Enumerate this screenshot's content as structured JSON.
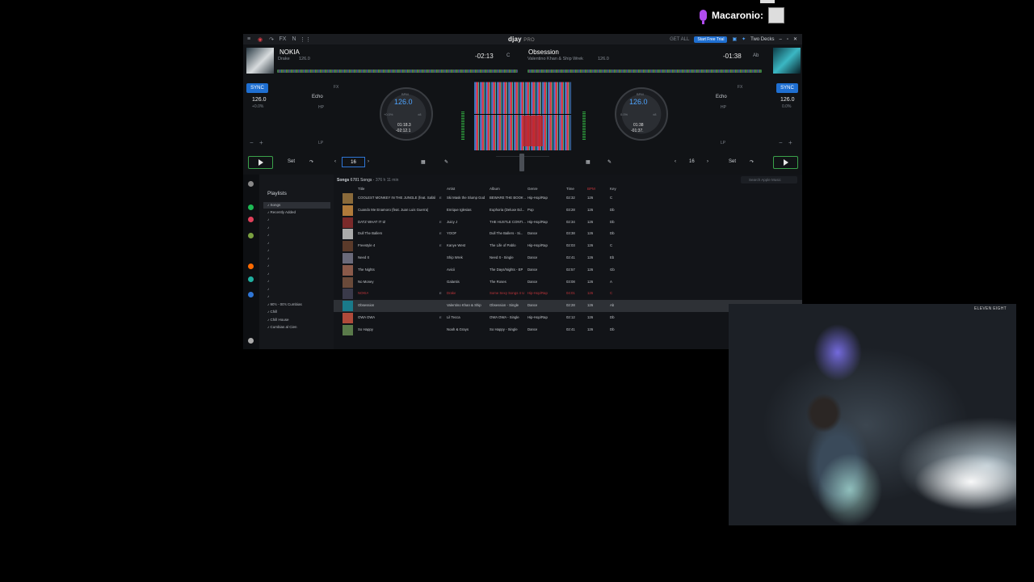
{
  "overlay": {
    "username": "Macaronio:"
  },
  "app": {
    "logo": "djay",
    "logo_sub": "PRO",
    "topbar_status": "GET ALL",
    "topbar_button": "Start Free Trial",
    "layout": "Two Decks"
  },
  "deck_left": {
    "title": "NOKIA",
    "artist": "Drake",
    "bpm_small": "126.0",
    "time": "-02:13",
    "key_small": "C",
    "sync": "SYNC",
    "bpm": "126.0",
    "pitch": "+0.0%",
    "fx": "Echo",
    "fx_tag": "FX",
    "hp": "HP",
    "lp": "LP",
    "jog_label": "BPM",
    "jog_bpm": "126.0",
    "jog_offset": "+0.0%",
    "jog_range": "±8",
    "jog_time1": "01:18.3",
    "jog_time2": "-02:12.1",
    "set": "Set",
    "loop": "16"
  },
  "deck_right": {
    "title": "Obsession",
    "artist": "Valentino Khan & Ship Wrek",
    "bpm_small": "126.0",
    "time": "-01:38",
    "key_small": "Ab",
    "sync": "SYNC",
    "bpm": "126.0",
    "pitch": "0.0%",
    "fx": "Echo",
    "fx_tag": "FX",
    "hp": "HP",
    "lp": "LP",
    "jog_label": "BPM",
    "jog_bpm": "126.0",
    "jog_offset": "0.0%",
    "jog_range": "±8",
    "jog_time1": "01:38",
    "jog_time2": "-01:37.",
    "set": "Set",
    "loop": "16"
  },
  "library": {
    "playlists_title": "Playlists",
    "breadcrumb": "Songs",
    "count": "6781 Songs",
    "duration": "376 h 11 min",
    "search_placeholder": "Search Apple Music",
    "columns": [
      "Title",
      "Artist",
      "Album",
      "Genre",
      "Time",
      "BPM",
      "Key"
    ],
    "playlists": [
      "Songs",
      "Recently Added",
      "",
      "",
      "",
      "",
      "",
      "",
      "",
      "",
      "",
      "",
      "",
      "90's - 00's Cumbias",
      "Chill",
      "Chill House",
      "Cumbias al Cien"
    ],
    "rows": [
      {
        "title": "COOLEST MONKEY IN THE JUNGLE (feat. Safaliobi)",
        "explicit": true,
        "artist": "Ski Mask the Slump God",
        "album": "BEWARE THE BOOK ...",
        "genre": "Hip-Hop/Rap",
        "time": "02:32",
        "bpm": "126",
        "key": "C"
      },
      {
        "title": "Cuando Me Enamoro (feat. Juan Luis Guerra)",
        "explicit": false,
        "artist": "Enrique Iglesias",
        "album": "Euphoria (Deluxe Ed...",
        "genre": "Pop",
        "time": "03:28",
        "bpm": "126",
        "key": "Db"
      },
      {
        "title": "DATZ WHAT IT IZ",
        "explicit": true,
        "artist": "Juicy J",
        "album": "THE HUSTLE CONTI...",
        "genre": "Hip-Hop/Rap",
        "time": "02:34",
        "bpm": "126",
        "key": "Db"
      },
      {
        "title": "Dull The Ballers",
        "explicit": true,
        "artist": "YOOF",
        "album": "Dull The Ballers - Si...",
        "genre": "Dance",
        "time": "03:38",
        "bpm": "126",
        "key": "Db"
      },
      {
        "title": "Freestyle 4",
        "explicit": true,
        "artist": "Kanye West",
        "album": "The Life of Pablo",
        "genre": "Hip-Hop/Rap",
        "time": "02:03",
        "bpm": "126",
        "key": "C"
      },
      {
        "title": "Need It",
        "explicit": false,
        "artist": "Ship Wrek",
        "album": "Need It - Single",
        "genre": "Dance",
        "time": "02:41",
        "bpm": "126",
        "key": "Eb"
      },
      {
        "title": "The Nights",
        "explicit": false,
        "artist": "Avicii",
        "album": "The Days/Nights - EP",
        "genre": "Dance",
        "time": "02:57",
        "bpm": "126",
        "key": "Gb"
      },
      {
        "title": "No Money",
        "explicit": false,
        "artist": "Galantis",
        "album": "The Roses",
        "genre": "Dance",
        "time": "03:08",
        "bpm": "126",
        "key": "A"
      },
      {
        "title": "NOKIA",
        "explicit": true,
        "artist": "Drake",
        "album": "Some Sexy Songs 4 U",
        "genre": "Hip-Hop/Rap",
        "time": "04:01",
        "bpm": "126",
        "key": "C"
      },
      {
        "title": "Obsession",
        "explicit": false,
        "artist": "Valentino Khan & Ship",
        "album": "Obsession - Single",
        "genre": "Dance",
        "time": "02:28",
        "bpm": "126",
        "key": "Ab"
      },
      {
        "title": "OWA OWA",
        "explicit": true,
        "artist": "Lil Tecca",
        "album": "OWA OWA - Single",
        "genre": "Hip-Hop/Rap",
        "time": "02:12",
        "bpm": "126",
        "key": "Db"
      },
      {
        "title": "So Happy",
        "explicit": false,
        "artist": "Noah & Grays",
        "album": "So Happy - Single",
        "genre": "Dance",
        "time": "02:41",
        "bpm": "126",
        "key": "Db"
      }
    ],
    "playing_row_index": 8,
    "selected_row_index": 9
  },
  "cam": {
    "watermark": "ELEVEN EIGHT"
  },
  "colors": {
    "accent": "#1f6fd1",
    "play": "#3aa14a",
    "playing": "#c2353b"
  }
}
